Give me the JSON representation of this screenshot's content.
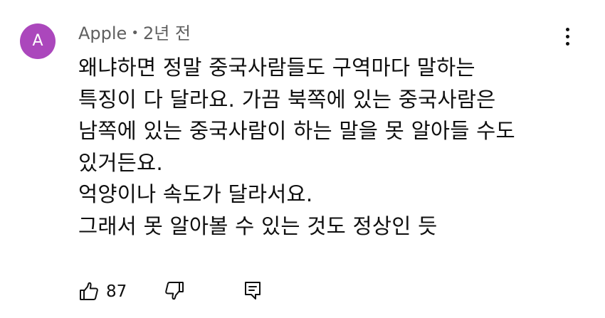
{
  "author": {
    "name": "Apple",
    "avatar_initial": "A",
    "avatar_color": "#ab47bc"
  },
  "meta": {
    "separator": "•",
    "timestamp": "2년 전"
  },
  "comment": {
    "lines": [
      "왜냐하면 정말 중국사람들도 구역마다 말하는",
      "특징이 다 달라요. 가끔 북쪽에 있는 중국사람은",
      "남쪽에 있는 중국사람이 하는 말을 못 알아들 수도",
      "있거든요.",
      "억양이나 속도가 달라서요.",
      "그래서 못 알아볼 수 있는 것도 정상인 듯"
    ]
  },
  "actions": {
    "like_count": "87",
    "like_icon": "thumbs-up-icon",
    "dislike_icon": "thumbs-down-icon",
    "reply_icon": "reply-icon",
    "menu_icon": "more-vert-icon"
  }
}
